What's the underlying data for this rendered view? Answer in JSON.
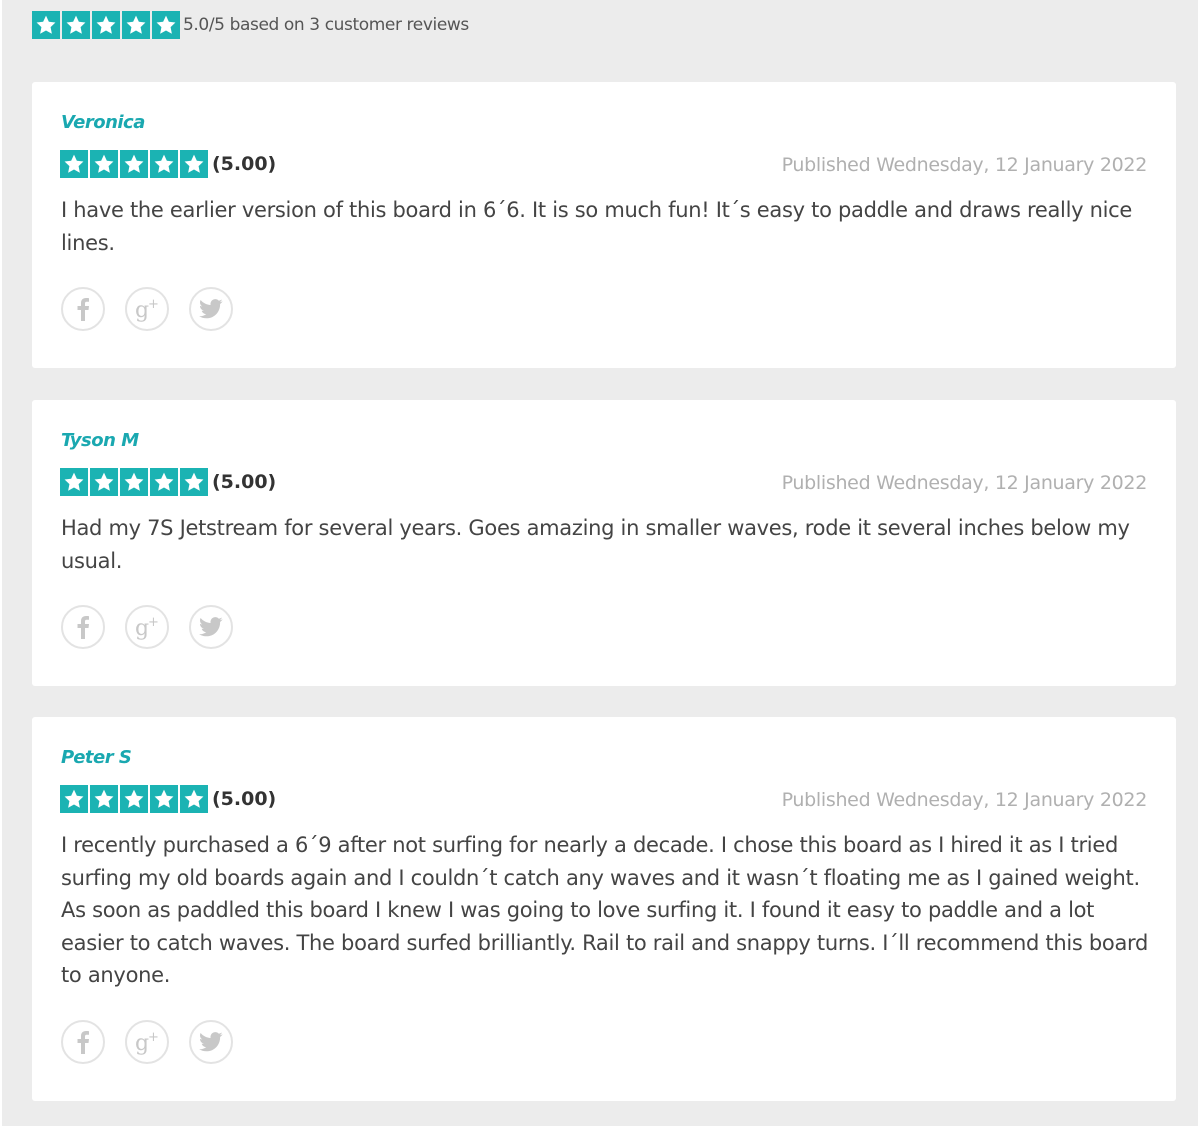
{
  "summary": {
    "text": "5.0/5 based on 3 customer reviews",
    "star_count": 5
  },
  "colors": {
    "accent": "#1bb3b3",
    "author": "#1aa8b0",
    "background": "#ececec"
  },
  "reviews": [
    {
      "author": "Veronica",
      "score": "(5.00)",
      "published": "Published Wednesday, 12 January 2022",
      "text": "I have the earlier version of this board in 6´6. It is so much fun! It´s easy to paddle and draws really nice lines."
    },
    {
      "author": "Tyson M",
      "score": "(5.00)",
      "published": "Published Wednesday, 12 January 2022",
      "text": "Had my 7S Jetstream for several years. Goes amazing in smaller waves, rode it several inches below my usual."
    },
    {
      "author": "Peter S",
      "score": "(5.00)",
      "published": "Published Wednesday, 12 January 2022",
      "text": "I recently purchased a 6´9 after not surfing for nearly a decade. I chose this board as I hired it as I tried surfing my old boards again and I couldn´t catch any waves and it wasn´t floating me as I gained weight. As soon as paddled this board I knew I was going to love surfing it. I found it easy to paddle and a lot easier to catch waves. The board surfed brilliantly. Rail to rail and snappy turns. I´ll recommend this board to anyone."
    }
  ],
  "share_icons": [
    "facebook-icon",
    "google-plus-icon",
    "twitter-icon"
  ]
}
